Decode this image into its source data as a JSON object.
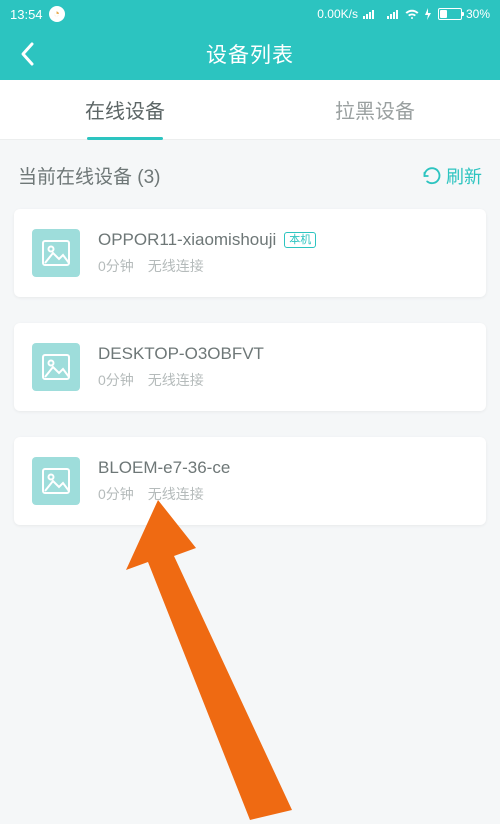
{
  "statusbar": {
    "time": "13:54",
    "netspeed": "0.00K/s",
    "battery": "30%"
  },
  "header": {
    "title": "设备列表"
  },
  "tabs": {
    "online": "在线设备",
    "blacklist": "拉黑设备"
  },
  "section": {
    "title": "当前在线设备  (3)",
    "refresh": "刷新"
  },
  "devices": [
    {
      "name": "OPPOR11-xiaomishouji",
      "tag": "本机",
      "duration": "0分钟",
      "conn": "无线连接"
    },
    {
      "name": "DESKTOP-O3OBFVT",
      "tag": "",
      "duration": "0分钟",
      "conn": "无线连接"
    },
    {
      "name": "BLOEM-e7-36-ce",
      "tag": "",
      "duration": "0分钟",
      "conn": "无线连接"
    }
  ]
}
